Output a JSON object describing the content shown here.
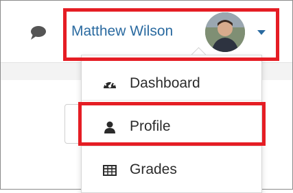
{
  "user_menu": {
    "name": "Matthew Wilson"
  },
  "dropdown": {
    "items": [
      {
        "label": "Dashboard",
        "icon": "dashboard-icon"
      },
      {
        "label": "Profile",
        "icon": "user-icon"
      },
      {
        "label": "Grades",
        "icon": "table-icon"
      }
    ]
  },
  "colors": {
    "link_blue": "#2a6aa0",
    "highlight_red": "#e51d24"
  }
}
